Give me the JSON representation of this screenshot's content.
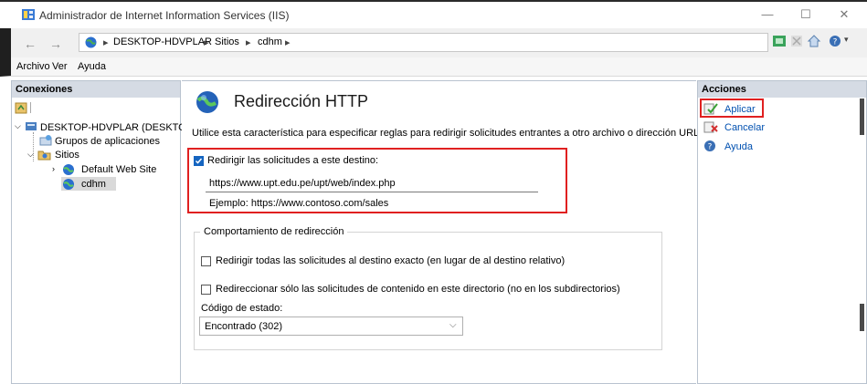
{
  "window": {
    "title": "Administrador de Internet Information Services (IIS)",
    "minimize": "—",
    "maximize": "☐",
    "close": "✕"
  },
  "address": {
    "crumbs": [
      "DESKTOP-HDVPLAR",
      "Sitios",
      "cdhm"
    ],
    "separator": "▸"
  },
  "menu": {
    "items": [
      "Archivo",
      "Ver",
      "Ayuda"
    ]
  },
  "connections": {
    "header": "Conexiones",
    "tree": {
      "server": "DESKTOP-HDVPLAR (DESKTO",
      "app_pools": "Grupos de aplicaciones",
      "sites": "Sitios",
      "default_site": "Default Web Site",
      "selected_site": "cdhm"
    }
  },
  "main": {
    "title": "Redirección HTTP",
    "description": "Utilice esta característica para especificar reglas para redirigir solicitudes entrantes a otro archivo o dirección URL.",
    "redirect_checkbox_label": "Redirigir las solicitudes a este destino:",
    "redirect_checked": true,
    "destination_url": "https://www.upt.edu.pe/upt/web/index.php",
    "example": "Ejemplo: https://www.contoso.com/sales",
    "behavior": {
      "title": "Comportamiento de redirección",
      "exact_destination_label": "Redirigir todas las solicitudes al destino exacto (en lugar de al destino relativo)",
      "exact_destination_checked": false,
      "only_content_label": "Redireccionar sólo las solicitudes de contenido en este directorio (no en los subdirectorios)",
      "only_content_checked": false,
      "status_code_label": "Código de estado:",
      "status_code_value": "Encontrado (302)"
    }
  },
  "actions": {
    "header": "Acciones",
    "apply": "Aplicar",
    "cancel": "Cancelar",
    "help": "Ayuda"
  },
  "colors": {
    "highlight": "#e02020",
    "link": "#0050b0",
    "pane_header": "#d5dbe4",
    "checkbox_checked": "#1565c0"
  }
}
